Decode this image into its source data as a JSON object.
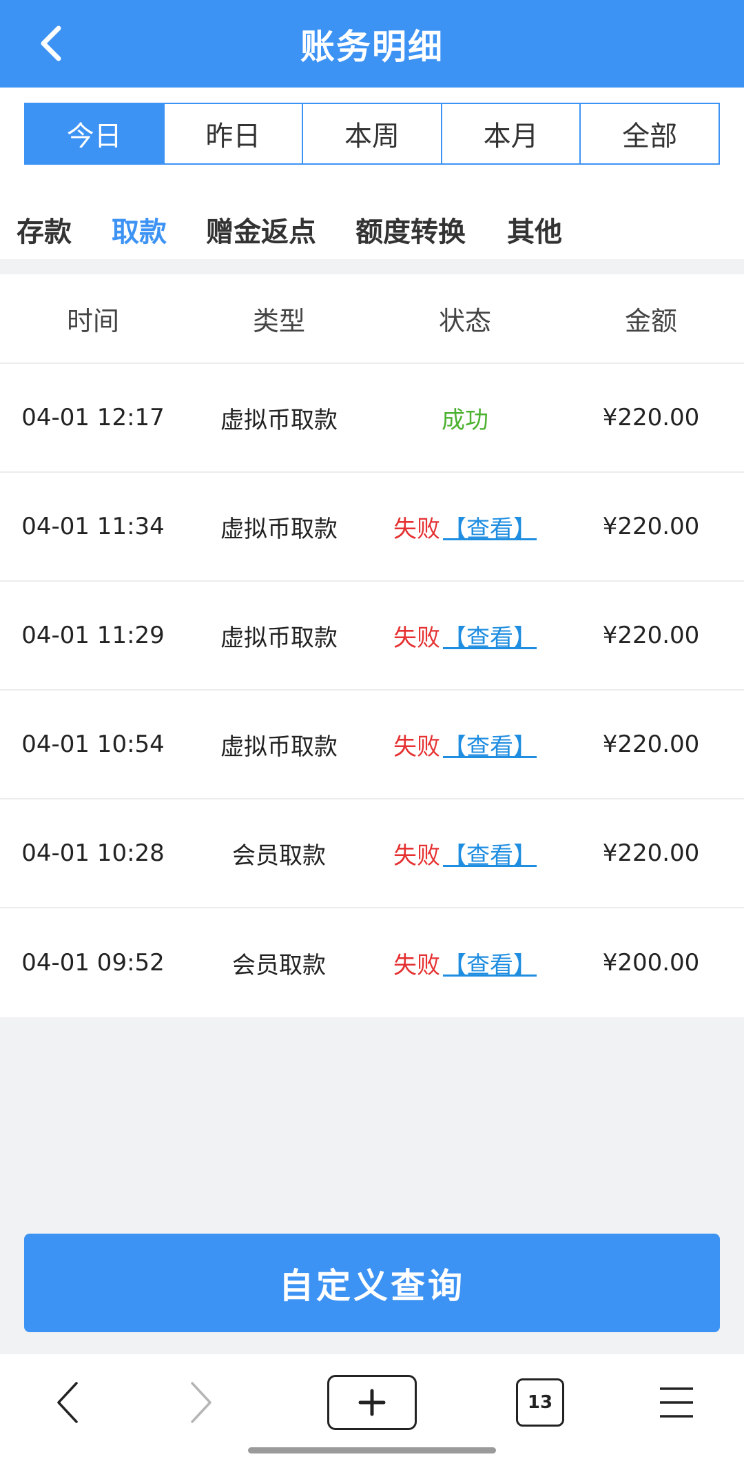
{
  "header": {
    "title": "账务明细",
    "back_icon": "chevron-left-icon"
  },
  "period_tabs": [
    {
      "label": "今日",
      "active": true
    },
    {
      "label": "昨日",
      "active": false
    },
    {
      "label": "本周",
      "active": false
    },
    {
      "label": "本月",
      "active": false
    },
    {
      "label": "全部",
      "active": false
    }
  ],
  "category_tabs": [
    {
      "label": "存款",
      "active": false
    },
    {
      "label": "取款",
      "active": true
    },
    {
      "label": "赠金返点",
      "active": false
    },
    {
      "label": "额度转换",
      "active": false
    },
    {
      "label": "其他",
      "active": false
    }
  ],
  "table": {
    "headers": [
      "时间",
      "类型",
      "状态",
      "金额"
    ],
    "rows": [
      {
        "time": "04-01 12:17",
        "type": "虚拟币取款",
        "status": "成功",
        "link": "",
        "amount": "¥220.00"
      },
      {
        "time": "04-01 11:34",
        "type": "虚拟币取款",
        "status": "失败",
        "link": "【查看】",
        "amount": "¥220.00"
      },
      {
        "time": "04-01 11:29",
        "type": "虚拟币取款",
        "status": "失败",
        "link": "【查看】",
        "amount": "¥220.00"
      },
      {
        "time": "04-01 10:54",
        "type": "虚拟币取款",
        "status": "失败",
        "link": "【查看】",
        "amount": "¥220.00"
      },
      {
        "time": "04-01 10:28",
        "type": "会员取款",
        "status": "失败",
        "link": "【查看】",
        "amount": "¥220.00"
      },
      {
        "time": "04-01 09:52",
        "type": "会员取款",
        "status": "失败",
        "link": "【查看】",
        "amount": "¥200.00"
      }
    ]
  },
  "query_button": {
    "label": "自定义查询"
  },
  "browser_bar": {
    "tab_count": "13"
  },
  "colors": {
    "accent": "#3d93f4",
    "success": "#4cb231",
    "fail": "#e53131",
    "link": "#1f8de0"
  }
}
